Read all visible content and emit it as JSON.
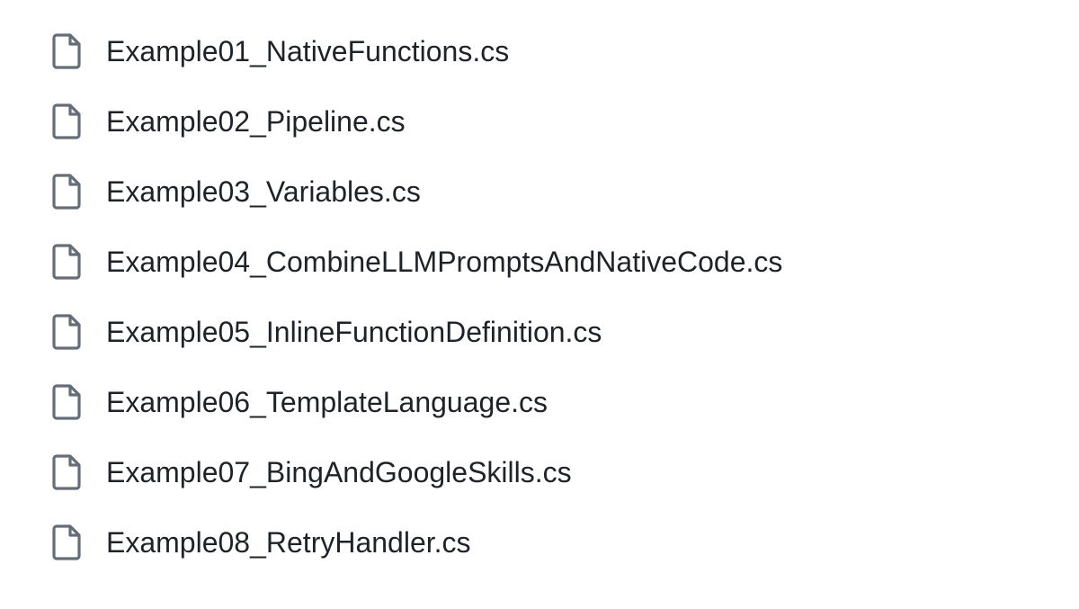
{
  "files": [
    {
      "name": "Example01_NativeFunctions.cs"
    },
    {
      "name": "Example02_Pipeline.cs"
    },
    {
      "name": "Example03_Variables.cs"
    },
    {
      "name": "Example04_CombineLLMPromptsAndNativeCode.cs"
    },
    {
      "name": "Example05_InlineFunctionDefinition.cs"
    },
    {
      "name": "Example06_TemplateLanguage.cs"
    },
    {
      "name": "Example07_BingAndGoogleSkills.cs"
    },
    {
      "name": "Example08_RetryHandler.cs"
    }
  ]
}
